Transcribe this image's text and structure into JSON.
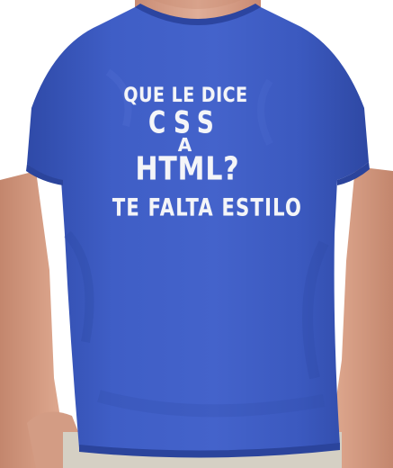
{
  "shirt_print": {
    "line1": "QUE LE DICE",
    "line2": "CSS",
    "line3": "A",
    "line4": "HTML?",
    "line5": "TE FALTA ESTILO"
  },
  "colors": {
    "shirt": "#3e5cc4",
    "shirt_shadow": "#2f4aa8",
    "skin": "#d9a58e",
    "print": "#f4f5f8",
    "background": "#ffffff"
  }
}
